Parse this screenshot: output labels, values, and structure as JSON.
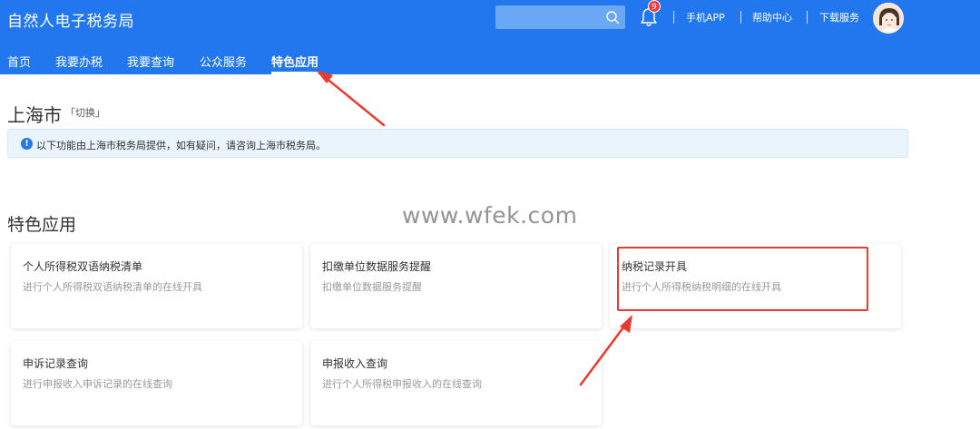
{
  "header": {
    "title": "自然人电子税务局",
    "search_placeholder": "",
    "notifications_count": "9",
    "links": [
      "手机APP",
      "帮助中心",
      "下载服务"
    ]
  },
  "nav": {
    "items": [
      "首页",
      "我要办税",
      "我要查询",
      "公众服务",
      "特色应用"
    ],
    "active_index": 4
  },
  "region": {
    "name": "上海市",
    "switch_label": "「切换」"
  },
  "notice": {
    "text": "以下功能由上海市税务局提供，如有疑问，请咨询上海市税务局。"
  },
  "section": {
    "title": "特色应用"
  },
  "cards": [
    {
      "title": "个人所得税双语纳税清单",
      "desc": "进行个人所得税双语纳税清单的在线开具"
    },
    {
      "title": "扣缴单位数据服务提醒",
      "desc": "扣缴单位数据服务提醒"
    },
    {
      "title": "纳税记录开具",
      "desc": "进行个人所得税纳税明细的在线开具"
    },
    {
      "title": "申诉记录查询",
      "desc": "进行申报收入申诉记录的在线查询"
    },
    {
      "title": "申报收入查询",
      "desc": "进行个人所得税申报收入的在线查询"
    }
  ],
  "watermark": "www.wfek.com",
  "colors": {
    "header_bg": "#2277ee",
    "notice_bg": "#eaf4fd",
    "annotation_red": "#e83a2e",
    "badge_red": "#f23a3a"
  }
}
